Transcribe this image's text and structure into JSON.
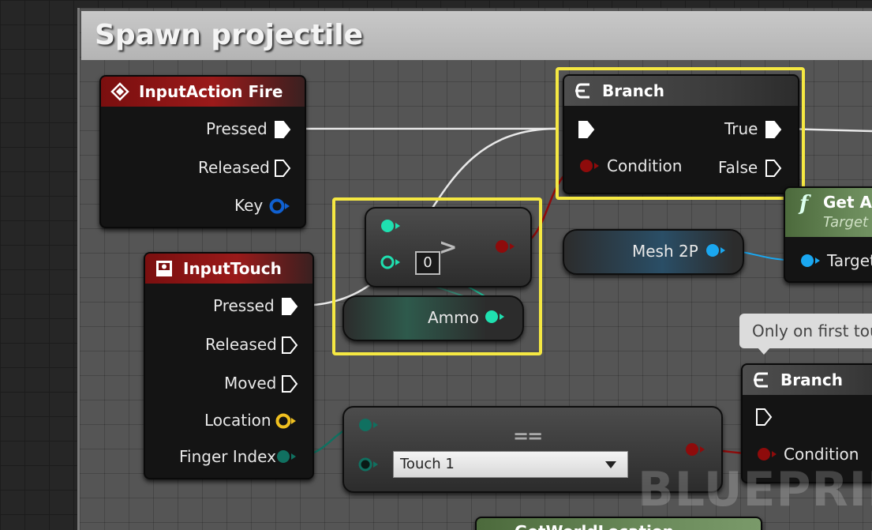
{
  "comment": {
    "title": "Spawn projectile"
  },
  "nodes": {
    "input_action_fire": {
      "title": "InputAction Fire",
      "pins": {
        "pressed": "Pressed",
        "released": "Released",
        "key": "Key"
      }
    },
    "input_touch": {
      "title": "InputTouch",
      "pins": {
        "pressed": "Pressed",
        "released": "Released",
        "moved": "Moved",
        "location": "Location",
        "finger_index": "Finger Index"
      }
    },
    "branch_main": {
      "title": "Branch",
      "pins": {
        "condition": "Condition",
        "true": "True",
        "false": "False"
      }
    },
    "compare": {
      "operator": ">",
      "default_value": "0"
    },
    "ammo": {
      "label": "Ammo"
    },
    "mesh2p": {
      "label": "Mesh 2P"
    },
    "get_node": {
      "title": "Get Ar",
      "subtitle": "Target",
      "pin": "Target"
    },
    "branch_second": {
      "title": "Branch",
      "pins": {
        "condition": "Condition"
      }
    },
    "equals": {
      "operator": "==",
      "dropdown_value": "Touch 1"
    },
    "bottom_node": {
      "title": "GetWorldLocation"
    }
  },
  "tooltip": {
    "text": "Only on first tou"
  },
  "watermark": "BLUEPRINT",
  "colors": {
    "exec": "#ffffff",
    "bool": "#8e0b0b",
    "int": "#1fe0b0",
    "object": "#1aa7f0",
    "struct_vector": "#f0c020",
    "key_struct": "#1060d0",
    "highlight": "#f5e842"
  }
}
